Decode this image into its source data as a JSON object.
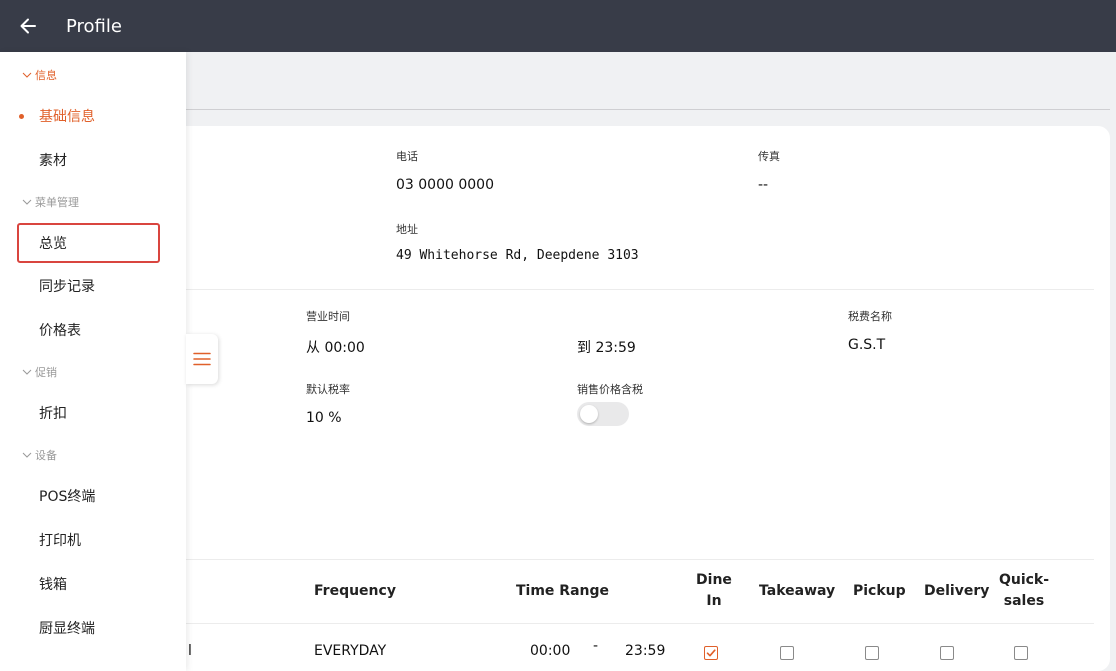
{
  "header": {
    "title": "Profile"
  },
  "colors": {
    "accent": "#e0602a",
    "header_bg": "#383c48",
    "highlight": "#d9453f"
  },
  "sidebar": {
    "sections": [
      {
        "label": "信息",
        "items": [
          {
            "label": "基础信息"
          },
          {
            "label": "素材"
          }
        ]
      },
      {
        "label": "菜单管理",
        "items": [
          {
            "label": "总览"
          },
          {
            "label": "同步记录"
          },
          {
            "label": "价格表"
          }
        ]
      },
      {
        "label": "促销",
        "items": [
          {
            "label": "折扣"
          }
        ]
      },
      {
        "label": "设备",
        "items": [
          {
            "label": "POS终端"
          },
          {
            "label": "打印机"
          },
          {
            "label": "钱箱"
          },
          {
            "label": "厨显终端"
          }
        ]
      }
    ],
    "active_item": "基础信息",
    "highlighted_item": "总览"
  },
  "contact": {
    "phone_label": "电话",
    "phone": "03 0000 0000",
    "fax_label": "传真",
    "fax": "--",
    "address_label": "地址",
    "address": "49 Whitehorse Rd, Deepdene 3103"
  },
  "business": {
    "hours_label": "营业时间",
    "hours_from": "从 00:00",
    "hours_to": "到 23:59",
    "tax_name_label": "税费名称",
    "tax_name": "G.S.T",
    "default_tax_label": "默认税率",
    "default_tax": "10 %",
    "price_incl_tax_label": "销售价格含税",
    "price_incl_tax": false
  },
  "schedule": {
    "headers": {
      "frequency": "Frequency",
      "time_range": "Time Range",
      "dine_in": [
        "Dine",
        "In"
      ],
      "takeaway": "Takeaway",
      "pickup": "Pickup",
      "delivery": "Delivery",
      "quick_sales": [
        "Quick-",
        "sales"
      ]
    },
    "rows": [
      {
        "name_fragment": "l",
        "frequency": "EVERYDAY",
        "start": "00:00",
        "separator": "-",
        "end": "23:59",
        "dine_in": true,
        "takeaway": false,
        "pickup": false,
        "delivery": false,
        "quick_sales": false
      }
    ]
  }
}
